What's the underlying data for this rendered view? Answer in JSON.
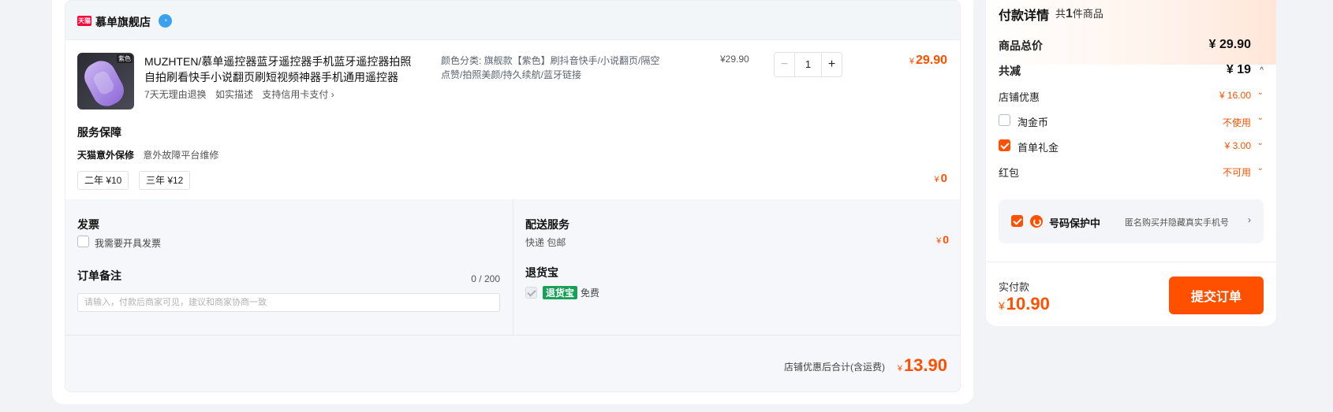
{
  "store": {
    "badge": "天猫",
    "name": "慕单旗舰店",
    "chat_icon": "wangwang-icon"
  },
  "item": {
    "image_tag": "紫色",
    "title": "MUZHTEN/慕单遥控器蓝牙遥控器手机蓝牙遥控器拍照自拍刷看快手小说翻页刷短视频神器手机通用遥控器",
    "services": [
      "7天无理由退换",
      "如实描述",
      "支持信用卡支付 ›"
    ],
    "sku": "颜色分类: 旗舰款【紫色】刷抖音快手/小说翻页/隔空点赞/拍照美颜/持久续航/蓝牙链接",
    "unit_price": "¥29.90",
    "qty_minus": "−",
    "quantity": "1",
    "qty_plus": "+",
    "total_yen": "¥",
    "total": "29.90"
  },
  "guarantee": {
    "title": "服务保障",
    "name": "天猫意外保修",
    "desc": "意外故障平台维修",
    "options": [
      "二年 ¥10",
      "三年 ¥12"
    ],
    "price_yen": "¥",
    "price": "0"
  },
  "invoice": {
    "title": "发票",
    "checkbox_label": "我需要开具发票"
  },
  "remark": {
    "title": "订单备注",
    "counter": "0 / 200",
    "placeholder": "请输入，付款后商家可见，建议和商家协商一致"
  },
  "delivery": {
    "title": "配送服务",
    "method": "快递 包邮",
    "fee_yen": "¥",
    "fee": "0"
  },
  "return_insurance": {
    "title": "退货宝",
    "badge": "退货宝",
    "label": "免费"
  },
  "store_footer": {
    "label": "店铺优惠后合计(含运费)",
    "total_yen": "¥",
    "total": "13.90"
  },
  "payment": {
    "title": "付款详情",
    "count_prefix": "共",
    "count": "1",
    "count_suffix": "件商品",
    "goods_total_label": "商品总价",
    "goods_total": "¥ 29.90",
    "discount_label": "共减",
    "discount": "¥ 19",
    "discount_chevron": "^",
    "store_discount_label": "店铺优惠",
    "store_discount": "¥ 16.00",
    "taojinbi_label": "淘金币",
    "taojinbi_value": "不使用",
    "first_gift_label": "首单礼金",
    "first_gift_value": "¥ 3.00",
    "redpacket_label": "红包",
    "redpacket_value": "不可用",
    "chevron": "⌄",
    "protect_title": "号码保护中",
    "protect_desc": "匿名购买并隐藏真实手机号",
    "protect_chevron": "›",
    "paid_label": "实付款",
    "paid_yen": "¥",
    "paid_amount": "10.90",
    "submit_label": "提交订单"
  },
  "colors": {
    "accent": "#ff5000",
    "tmall_red": "#ff0036",
    "return_green": "#18a058",
    "background": "#f2f3f6"
  }
}
